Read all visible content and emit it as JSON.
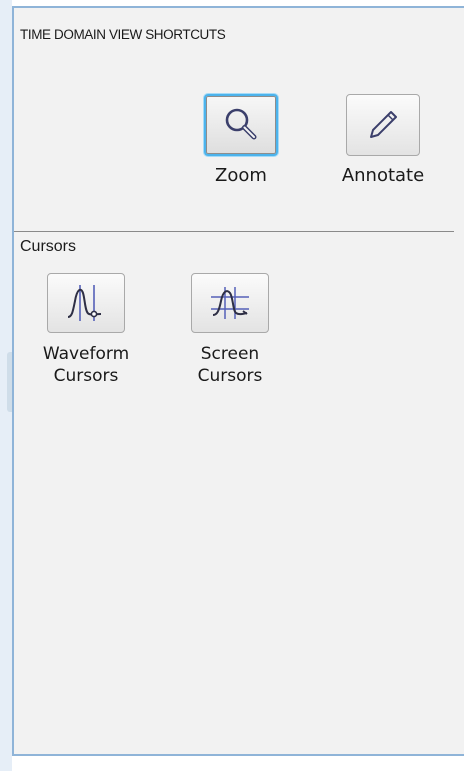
{
  "panel": {
    "title": "TIME DOMAIN VIEW SHORTCUTS"
  },
  "shortcuts": [
    {
      "label": "Zoom",
      "icon": "magnifier-icon",
      "selected": true
    },
    {
      "label": "Annotate",
      "icon": "pencil-icon",
      "selected": false
    }
  ],
  "cursors": {
    "section_label": "Cursors",
    "items": [
      {
        "label": "Waveform\nCursors",
        "icon": "waveform-cursors-icon"
      },
      {
        "label": "Screen\nCursors",
        "icon": "screen-cursors-icon"
      }
    ]
  },
  "colors": {
    "selection_accent": "#4cb3ec",
    "icon_stroke": "#3b3f6b",
    "cursor_line": "#5560b8",
    "panel_background": "#f2f2f2"
  }
}
